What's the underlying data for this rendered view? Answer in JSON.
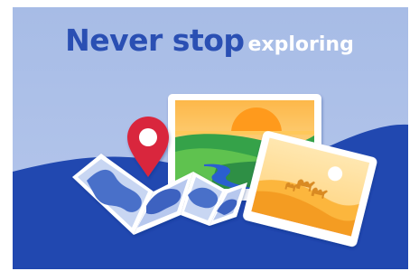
{
  "headline": {
    "strong_text": "Never stop",
    "soft_text": "exploring"
  },
  "colors": {
    "sky": "#a9bde6",
    "wave": "#2148b0",
    "title_blue": "#2a4fb3",
    "pin": "#d9283e",
    "photo_frame": "#ffffff",
    "desert_sun": "#ffffff"
  },
  "icons": {
    "pin": "map-pin-icon",
    "camel": "camel-icon"
  }
}
